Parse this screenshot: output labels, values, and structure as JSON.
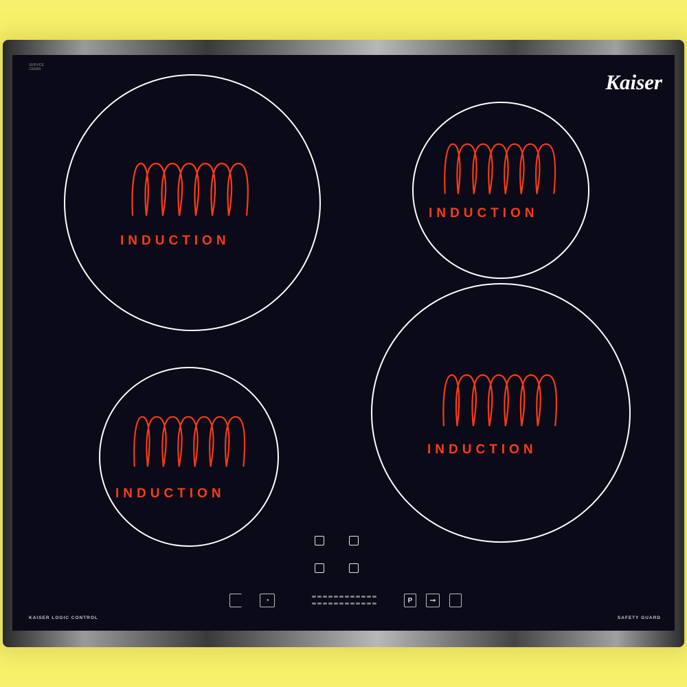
{
  "brand": "Kaiser",
  "zones": [
    {
      "id": "front-left-large",
      "label": "INDUCTION"
    },
    {
      "id": "back-right-small",
      "label": "INDUCTION"
    },
    {
      "id": "front-left-small",
      "label": "INDUCTION"
    },
    {
      "id": "front-right-large",
      "label": "INDUCTION"
    }
  ],
  "footer": {
    "left_text": "KAISER LOGIC CONTROL",
    "right_text": "SAFETY GUARD"
  },
  "corner_badge": [
    "SERVICE",
    "CERAN"
  ],
  "control_panel": {
    "pause_label": "P",
    "lock_symbol": "⊸"
  },
  "colors": {
    "background": "#f6f06a",
    "glass": "#0b0a18",
    "coil": "#ff3b14",
    "zone_ring": "#ffffff"
  }
}
